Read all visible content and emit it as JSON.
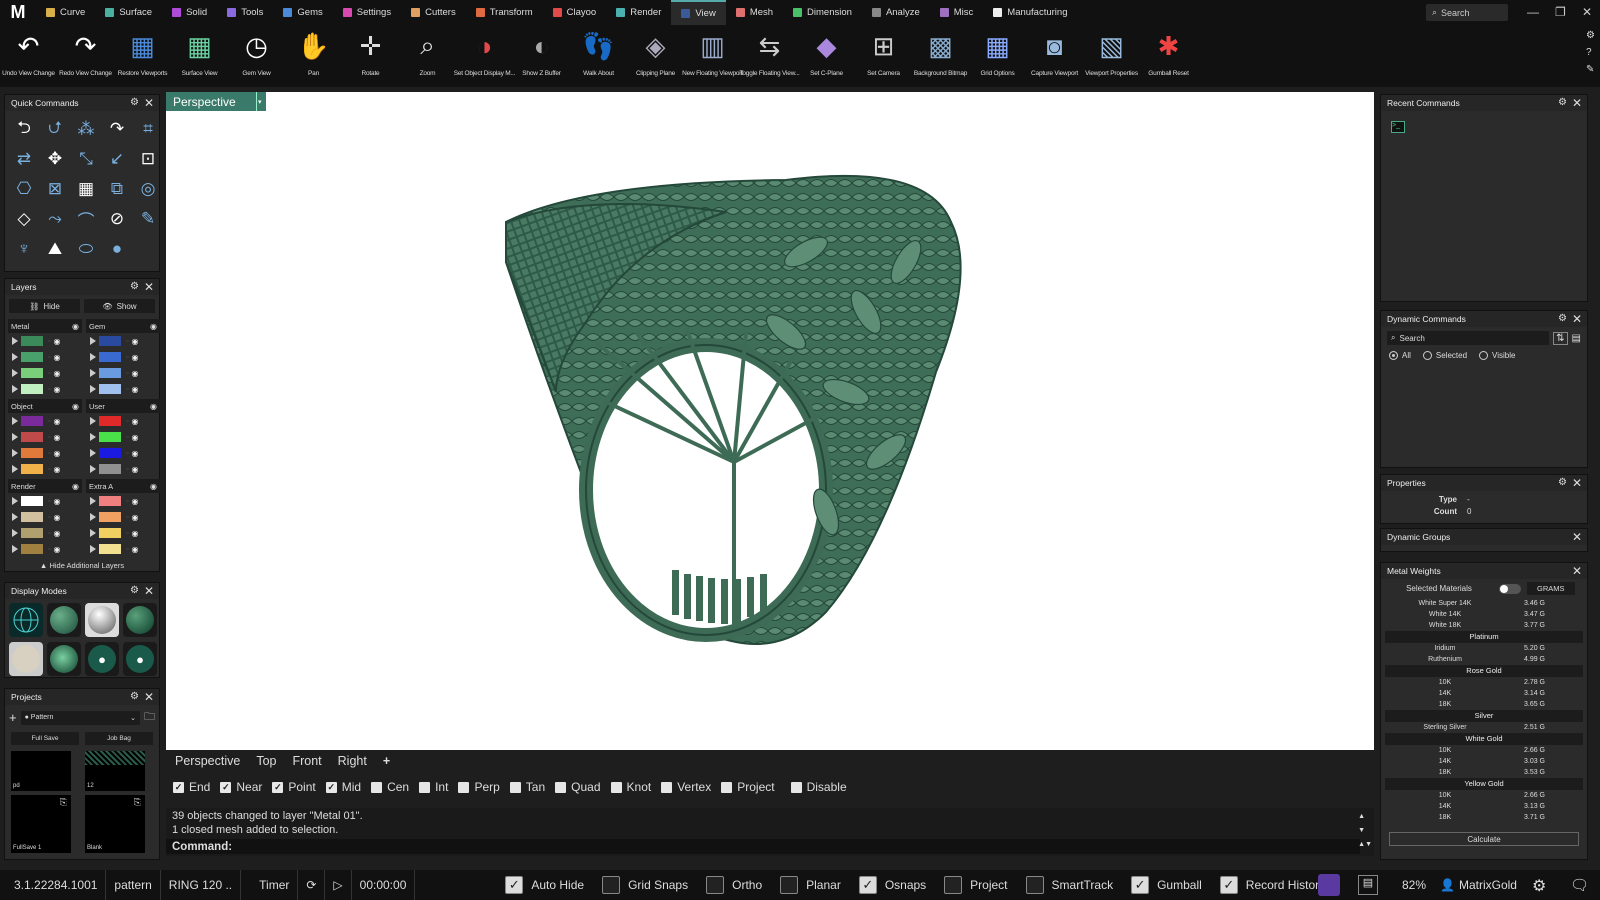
{
  "menu": {
    "logo": "M",
    "items": [
      {
        "label": "Curve",
        "color": "#d8b04a"
      },
      {
        "label": "Surface",
        "color": "#4ab0a0"
      },
      {
        "label": "Solid",
        "color": "#b04ad8"
      },
      {
        "label": "Tools",
        "color": "#8a6ae0"
      },
      {
        "label": "Gems",
        "color": "#4a8ad8"
      },
      {
        "label": "Settings",
        "color": "#d84ab0"
      },
      {
        "label": "Cutters",
        "color": "#e0a060"
      },
      {
        "label": "Transform",
        "color": "#e06a40"
      },
      {
        "label": "Clayoo",
        "color": "#e04a4a"
      },
      {
        "label": "Render",
        "color": "#4ab0b0"
      },
      {
        "label": "View",
        "color": "#3a5a9a"
      },
      {
        "label": "Mesh",
        "color": "#e07070"
      },
      {
        "label": "Dimension",
        "color": "#4ac06a"
      },
      {
        "label": "Analyze",
        "color": "#888888"
      },
      {
        "label": "Misc",
        "color": "#a070c0"
      },
      {
        "label": "Manufacturing",
        "color": "#eeeeee"
      }
    ],
    "search": "Search"
  },
  "toolbar": [
    {
      "label": "Undo View Change",
      "icon": "undo-view-icon"
    },
    {
      "label": "Redo View Change",
      "icon": "redo-view-icon"
    },
    {
      "label": "Restore Viewports",
      "icon": "viewports-icon"
    },
    {
      "label": "Surface View",
      "icon": "surface-view-icon"
    },
    {
      "label": "Gem View",
      "icon": "gem-view-icon"
    },
    {
      "label": "Pan",
      "icon": "pan-hand-icon"
    },
    {
      "label": "Rotate",
      "icon": "rotate-icon"
    },
    {
      "label": "Zoom",
      "icon": "zoom-icon"
    },
    {
      "label": "Set Object Display M...",
      "icon": "display-mode-icon"
    },
    {
      "label": "Show Z Buffer",
      "icon": "z-buffer-icon"
    },
    {
      "label": "Walk About",
      "icon": "footprints-icon"
    },
    {
      "label": "Clipping Plane",
      "icon": "clipping-plane-icon"
    },
    {
      "label": "New Floating Viewport",
      "icon": "floating-viewport-icon"
    },
    {
      "label": "Toggle Floating View...",
      "icon": "toggle-floating-icon"
    },
    {
      "label": "Set C-Plane",
      "icon": "cplane-icon"
    },
    {
      "label": "Set Camera",
      "icon": "camera-grid-icon"
    },
    {
      "label": "Background Bitmap",
      "icon": "bitmap-icon"
    },
    {
      "label": "Grid Options",
      "icon": "grid-options-icon"
    },
    {
      "label": "Capture Viewport",
      "icon": "capture-icon"
    },
    {
      "label": "Viewport Properties",
      "icon": "viewport-properties-icon"
    },
    {
      "label": "Gumball Reset",
      "icon": "gumball-reset-icon"
    }
  ],
  "quick_commands": {
    "title": "Quick Commands"
  },
  "layers": {
    "title": "Layers",
    "hide": "Hide",
    "show": "Show",
    "groups": [
      {
        "name": "Metal",
        "colors": [
          "#3a8a5a",
          "#4aa06a",
          "#7ad07a",
          "#c0f0c0"
        ]
      },
      {
        "name": "Gem",
        "colors": [
          "#2a4aa0",
          "#3a6ad0",
          "#6a9ae0",
          "#a0c0f0"
        ]
      },
      {
        "name": "Object",
        "colors": [
          "#7a2a9a",
          "#c04a4a",
          "#e07a3a",
          "#f0b04a"
        ]
      },
      {
        "name": "User",
        "colors": [
          "#e02a2a",
          "#4ae04a",
          "#1a1ae0",
          "#909090"
        ]
      },
      {
        "name": "Render",
        "colors": [
          "#ffffff",
          "#d0c0a0",
          "#b0a070",
          "#a08040"
        ]
      },
      {
        "name": "Extra A",
        "colors": [
          "#f08080",
          "#f0a060",
          "#f0d060",
          "#f0e090"
        ]
      }
    ],
    "hide_additional": "Hide Additional Layers"
  },
  "display_modes": {
    "title": "Display Modes"
  },
  "projects": {
    "title": "Projects",
    "selected": "Pattern",
    "full_save": "Full Save",
    "job_bag": "Job Bag",
    "thumbs": [
      {
        "label": "pd"
      },
      {
        "label": "12"
      },
      {
        "label": "FullSave 1"
      },
      {
        "label": "Blank"
      }
    ]
  },
  "viewport": {
    "name": "Perspective",
    "tabs": [
      "Perspective",
      "Top",
      "Front",
      "Right"
    ],
    "add": "+"
  },
  "osnaps": [
    {
      "label": "End",
      "on": true
    },
    {
      "label": "Near",
      "on": true
    },
    {
      "label": "Point",
      "on": true
    },
    {
      "label": "Mid",
      "on": true
    },
    {
      "label": "Cen",
      "on": false
    },
    {
      "label": "Int",
      "on": false
    },
    {
      "label": "Perp",
      "on": false
    },
    {
      "label": "Tan",
      "on": false
    },
    {
      "label": "Quad",
      "on": false
    },
    {
      "label": "Knot",
      "on": false
    },
    {
      "label": "Vertex",
      "on": false
    },
    {
      "label": "Project",
      "on": false
    },
    {
      "label": "Disable",
      "on": false
    }
  ],
  "command": {
    "history": [
      "39 objects changed to layer \"Metal 01\".",
      "1 closed mesh added to selection."
    ],
    "prompt": "Command:"
  },
  "recent_commands": {
    "title": "Recent Commands"
  },
  "dynamic_commands": {
    "title": "Dynamic Commands",
    "search": "Search",
    "filters": [
      {
        "label": "All",
        "on": true
      },
      {
        "label": "Selected",
        "on": false
      },
      {
        "label": "Visible",
        "on": false
      }
    ]
  },
  "properties": {
    "title": "Properties",
    "type_label": "Type",
    "type_value": "-",
    "count_label": "Count",
    "count_value": "0"
  },
  "dynamic_groups": {
    "title": "Dynamic Groups"
  },
  "metal_weights": {
    "title": "Metal Weights",
    "selected_materials": "Selected Materials",
    "unit": "GRAMS",
    "calculate": "Calculate",
    "rows": [
      {
        "kind": "row",
        "name": "White Super 14K",
        "value": "3.46 G"
      },
      {
        "kind": "row",
        "name": "White 14K",
        "value": "3.47 G"
      },
      {
        "kind": "row",
        "name": "White 18K",
        "value": "3.77 G"
      },
      {
        "kind": "group",
        "name": "Platinum"
      },
      {
        "kind": "row",
        "name": "Iridium",
        "value": "5.20 G"
      },
      {
        "kind": "row",
        "name": "Ruthenium",
        "value": "4.99 G"
      },
      {
        "kind": "group",
        "name": "Rose Gold"
      },
      {
        "kind": "row",
        "name": "10K",
        "value": "2.78 G"
      },
      {
        "kind": "row",
        "name": "14K",
        "value": "3.14 G"
      },
      {
        "kind": "row",
        "name": "18K",
        "value": "3.65 G"
      },
      {
        "kind": "group",
        "name": "Silver"
      },
      {
        "kind": "row",
        "name": "Sterling Silver",
        "value": "2.51 G"
      },
      {
        "kind": "group",
        "name": "White Gold"
      },
      {
        "kind": "row",
        "name": "10K",
        "value": "2.66 G"
      },
      {
        "kind": "row",
        "name": "14K",
        "value": "3.03 G"
      },
      {
        "kind": "row",
        "name": "18K",
        "value": "3.53 G"
      },
      {
        "kind": "group",
        "name": "Yellow Gold"
      },
      {
        "kind": "row",
        "name": "10K",
        "value": "2.66 G"
      },
      {
        "kind": "row",
        "name": "14K",
        "value": "3.13 G"
      },
      {
        "kind": "row",
        "name": "18K",
        "value": "3.71 G"
      }
    ]
  },
  "status": {
    "version": "3.1.22284.1001",
    "project": "pattern",
    "file": "RING 120 ..",
    "timer": "Timer",
    "time": "00:00:00",
    "toggles": [
      {
        "label": "Auto Hide",
        "on": true
      },
      {
        "label": "Grid Snaps",
        "on": false
      },
      {
        "label": "Ortho",
        "on": false
      },
      {
        "label": "Planar",
        "on": false
      },
      {
        "label": "Osnaps",
        "on": true
      },
      {
        "label": "Project",
        "on": false
      },
      {
        "label": "SmartTrack",
        "on": false
      },
      {
        "label": "Gumball",
        "on": true
      },
      {
        "label": "Record History",
        "on": true
      }
    ],
    "zoom": "82%",
    "user": "MatrixGold"
  }
}
